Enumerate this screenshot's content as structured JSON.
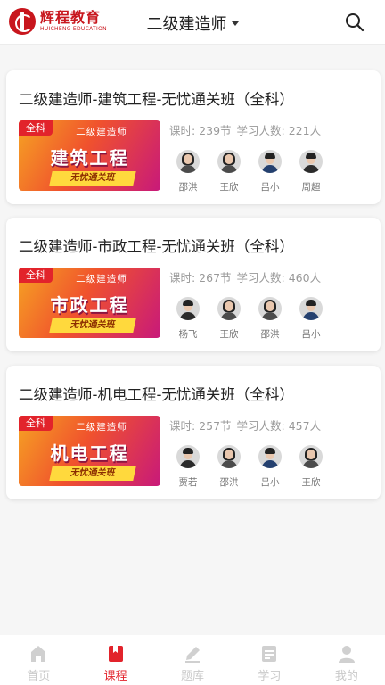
{
  "header": {
    "logo_cn": "辉程教育",
    "logo_en": "HUICHENG EDUCATION",
    "title": "二级建造师",
    "search_icon": "search-icon"
  },
  "courses": [
    {
      "title": "二级建造师-建筑工程-无忧通关班（全科）",
      "banner_tag": "全科",
      "banner_sub": "二级建造师",
      "banner_main": "建筑工程",
      "banner_ribbon": "无忧通关班",
      "lessons": "课时: 239节",
      "students": "学习人数: 221人",
      "teachers": [
        "邵洪",
        "王欣",
        "吕小",
        "周超"
      ]
    },
    {
      "title": "二级建造师-市政工程-无忧通关班（全科）",
      "banner_tag": "全科",
      "banner_sub": "二级建造师",
      "banner_main": "市政工程",
      "banner_ribbon": "无忧通关班",
      "lessons": "课时: 267节",
      "students": "学习人数: 460人",
      "teachers": [
        "杨飞",
        "王欣",
        "邵洪",
        "吕小"
      ]
    },
    {
      "title": "二级建造师-机电工程-无忧通关班（全科）",
      "banner_tag": "全科",
      "banner_sub": "二级建造师",
      "banner_main": "机电工程",
      "banner_ribbon": "无忧通关班",
      "lessons": "课时: 257节",
      "students": "学习人数: 457人",
      "teachers": [
        "贾若",
        "邵洪",
        "吕小",
        "王欣"
      ]
    }
  ],
  "tabbar": {
    "items": [
      {
        "label": "首页",
        "icon": "home-icon"
      },
      {
        "label": "课程",
        "icon": "course-book-icon"
      },
      {
        "label": "题库",
        "icon": "pencil-icon"
      },
      {
        "label": "学习",
        "icon": "study-notes-icon"
      },
      {
        "label": "我的",
        "icon": "profile-icon"
      }
    ],
    "active_index": 1
  },
  "colors": {
    "brand_red": "#e2232b",
    "inactive_gray": "#c9c9c9"
  }
}
